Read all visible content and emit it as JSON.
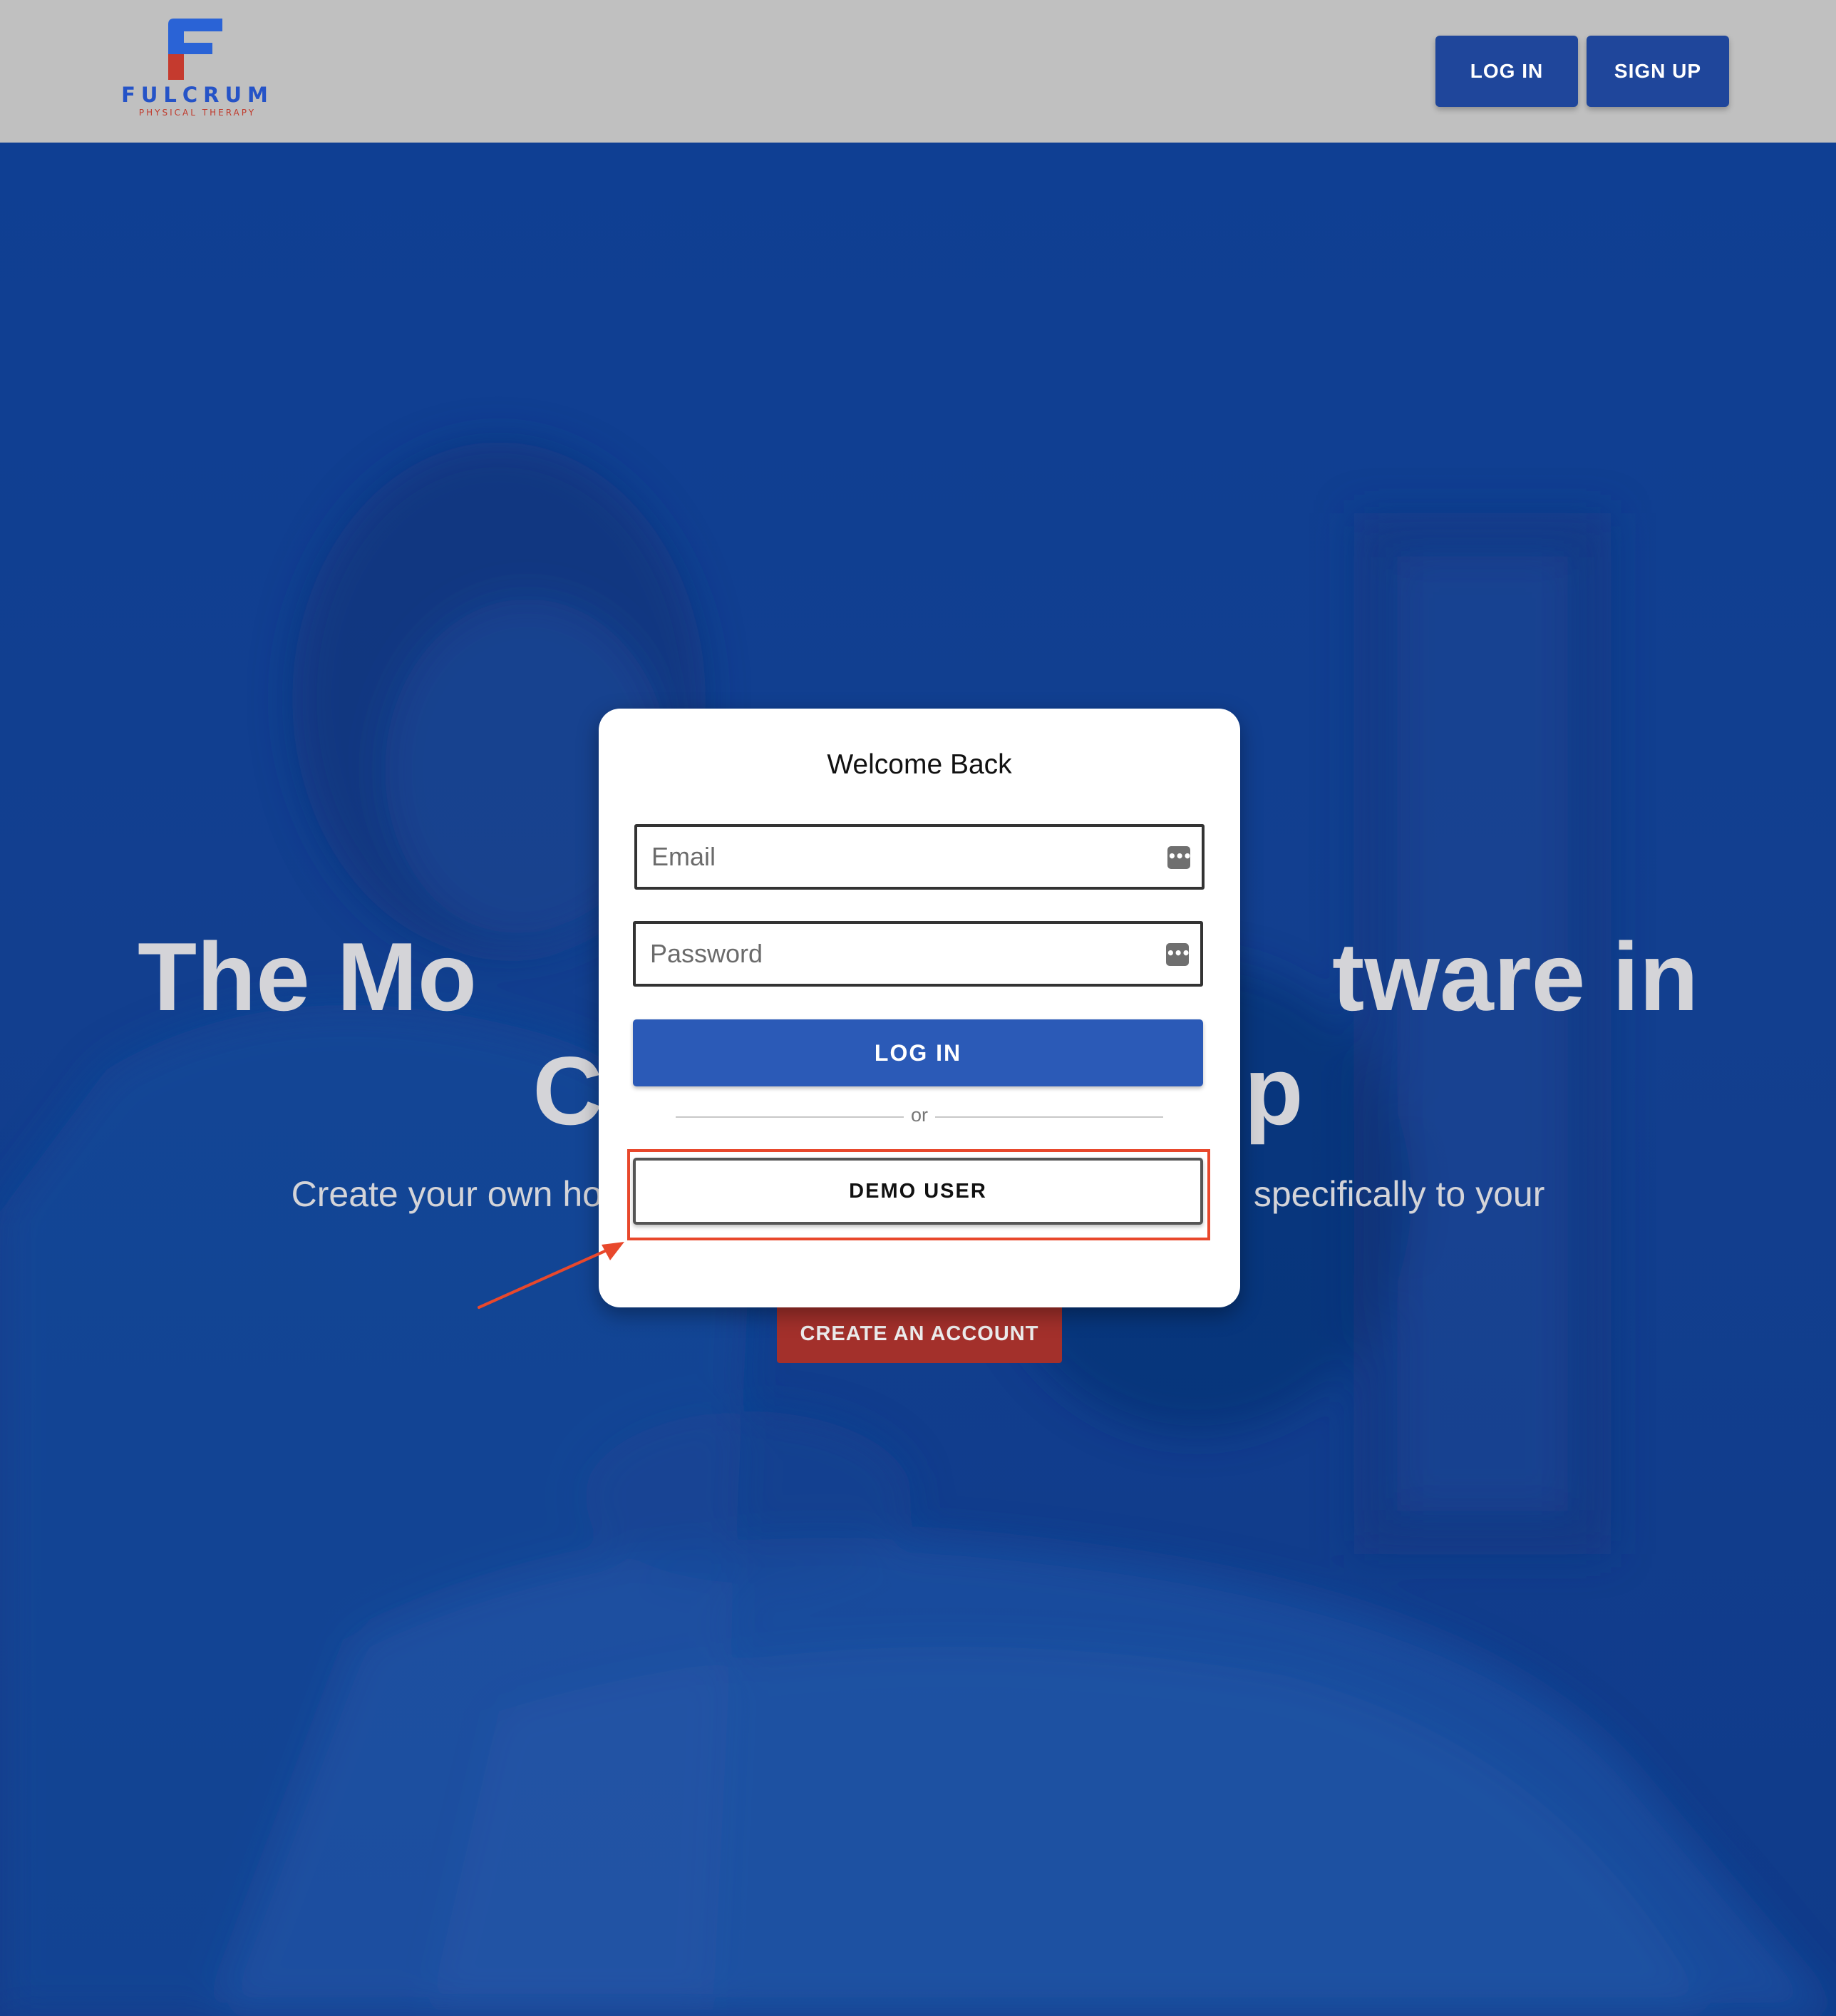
{
  "brand": {
    "name": "FULCRUM",
    "tagline": "PHYSICAL THERAPY",
    "primary_color": "#2553c7",
    "accent_color": "#c0392b"
  },
  "header": {
    "login_label": "LOG IN",
    "signup_label": "SIGN UP",
    "background_color": "#c0c0c0",
    "button_color": "#1f469b"
  },
  "hero": {
    "title_part1": "The ",
    "title_bold": "Mo",
    "title_part2": "tware in",
    "title_line2_left": "C",
    "title_line2_right": "p",
    "subtitle_left": "Create your own ho",
    "subtitle_right": " specifically to your",
    "create_account_label": "CREATE AN ACCOUNT",
    "create_account_color": "#a3302b",
    "overlay_color": "#13408f"
  },
  "login_modal": {
    "title": "Welcome Back",
    "email_placeholder": "Email",
    "password_placeholder": "Password",
    "login_label": "LOG IN",
    "divider_text": "or",
    "demo_label": "DEMO USER",
    "login_button_color": "#2b5ab7",
    "autofill_icon": "ellipsis-key-icon",
    "autofill_glyph": "•••"
  },
  "annotation": {
    "highlight_color": "#e8482c",
    "target": "demo-user-button"
  }
}
